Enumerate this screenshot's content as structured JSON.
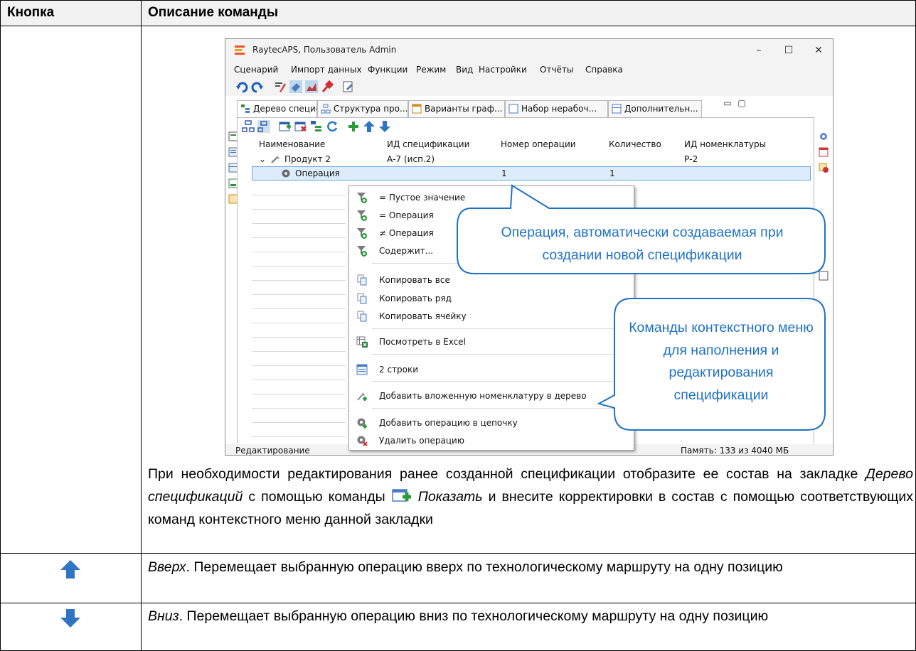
{
  "table": {
    "header_col1": "Кнопка",
    "header_col2": "Описание команды"
  },
  "app": {
    "title": "RaytecAPS, Пользователь Admin",
    "window_controls": [
      "–",
      "☐",
      "✕"
    ],
    "menu": [
      "Сценарий",
      "Импорт данных",
      "Функции",
      "Режим",
      "Вид",
      "Настройки",
      "Отчёты",
      "Справка"
    ],
    "tabs": [
      "Дерево специф...",
      "Структура про...",
      "Варианты граф...",
      "Набор нерабоч...",
      "Дополнительн..."
    ],
    "grid": {
      "columns": [
        "Наименование",
        "ИД спецификации",
        "Номер операции",
        "Количество",
        "ИД номенклатуры"
      ],
      "rows": [
        {
          "name": "Продукт 2",
          "spec_id": "А-7 (исп.2)",
          "op_num": "",
          "qty": "",
          "nom_id": "Р-2"
        },
        {
          "name": "Операция",
          "spec_id": "",
          "op_num": "1",
          "qty": "1",
          "nom_id": ""
        }
      ]
    },
    "status": {
      "left": "Редактирование",
      "right": "Память: 133 из 4040 МБ"
    }
  },
  "context_menu": {
    "items": [
      {
        "label": "= Пустое значение",
        "icon": "filter-add-icon"
      },
      {
        "label": "= Операция",
        "icon": "filter-add-icon"
      },
      {
        "label": "≠ Операция",
        "icon": "filter-add-icon"
      },
      {
        "label": "Содержит...",
        "icon": "filter-add-icon"
      },
      {
        "label": "Копировать все",
        "icon": "copy-icon"
      },
      {
        "label": "Копировать ряд",
        "icon": "copy-icon"
      },
      {
        "label": "Копировать ячейку",
        "icon": "copy-icon"
      },
      {
        "label": "Посмотреть в Excel",
        "icon": "excel-icon"
      },
      {
        "label": "2 строки",
        "icon": "rows-icon"
      },
      {
        "label": "Добавить вложенную номенклатуру в дерево",
        "icon": "add-nested-icon"
      },
      {
        "label": "Добавить операцию в цепочку",
        "icon": "gear-add-icon"
      },
      {
        "label": "Удалить операцию",
        "icon": "gear-delete-icon"
      }
    ]
  },
  "callouts": {
    "operation": "Операция, автоматически создаваемая при создании новой спецификации",
    "commands": "Команды контекстного меню для наполнения и редактирования спецификации"
  },
  "text": {
    "para1_a": "При необходимости редактирования ранее созданной спецификации отобразите ее состав на закладке ",
    "para1_tab": "Дерево спецификаций",
    "para1_b": " с помощью команды ",
    "para1_cmd": "Показать",
    "para1_c": " и внесите корректировки в состав с помощью соответствующих команд контекстного меню данной закладки",
    "up_title": "Вверх",
    "up_desc": ". Перемещает выбранную операцию вверх по технологическому маршруту на одну позицию",
    "down_title": "Вниз",
    "down_desc": ". Перемещает выбранную операцию вниз по технологическому маршруту на одну позицию"
  },
  "colors": {
    "arrow_blue": "#2e75c3",
    "callout_blue": "#1f72c4",
    "selection": "#dcecfb"
  }
}
